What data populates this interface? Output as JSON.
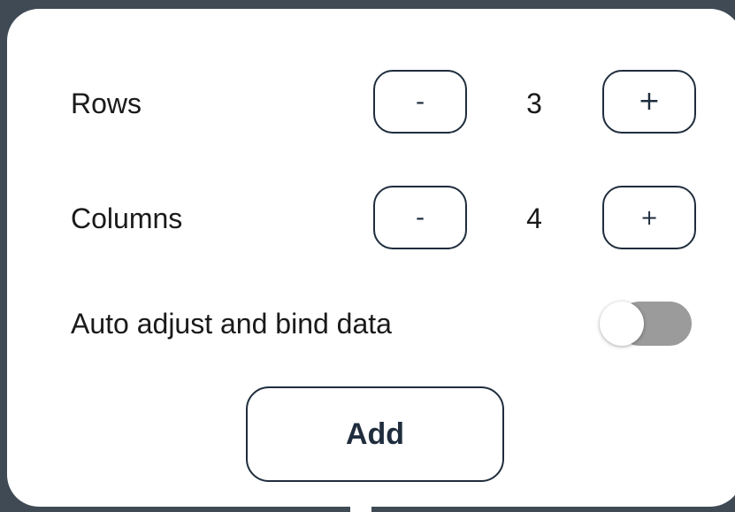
{
  "rows": {
    "label": "Rows",
    "value": "3",
    "decrement_label": "-",
    "increment_label": "+"
  },
  "columns": {
    "label": "Columns",
    "value": "4",
    "decrement_label": "-",
    "increment_label": "+"
  },
  "auto_adjust": {
    "label": "Auto adjust and bind data",
    "enabled": false
  },
  "add_button": {
    "label": "Add"
  },
  "colors": {
    "backdrop": "#3f4a55",
    "panel": "#ffffff",
    "outline": "#1f2d3d",
    "toggle_track_off": "#9b9b9b"
  }
}
